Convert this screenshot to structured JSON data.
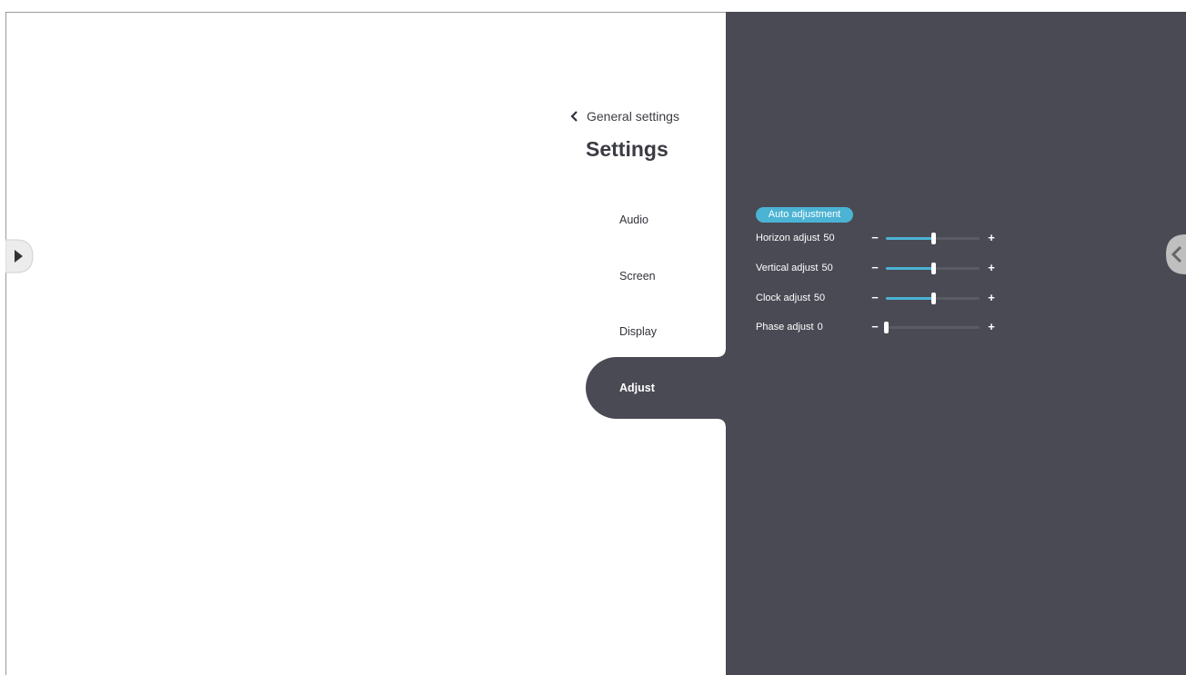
{
  "header": {
    "back_label": "General settings",
    "title": "Settings"
  },
  "menu": {
    "items": [
      {
        "label": "Audio",
        "active": false
      },
      {
        "label": "Screen",
        "active": false
      },
      {
        "label": "Display",
        "active": false
      },
      {
        "label": "Adjust",
        "active": true
      }
    ]
  },
  "adjust": {
    "auto_label": "Auto adjustment",
    "rows": [
      {
        "label": "Horizon adjust",
        "value": "50",
        "level": 0.5
      },
      {
        "label": "Vertical adjust",
        "value": "50",
        "level": 0.5
      },
      {
        "label": "Clock adjust",
        "value": "50",
        "level": 0.5
      },
      {
        "label": "Phase adjust",
        "value": "0",
        "level": 0
      }
    ],
    "minus_symbol": "−",
    "plus_symbol": "+"
  },
  "colors": {
    "accent": "#4bb3d4",
    "panel": "#4a4a55",
    "text_dark": "#3b3b44"
  },
  "icons": {
    "back": "chevron-left-icon",
    "left_handle": "expand-arrow-icon",
    "right_handle": "collapse-arrow-icon"
  }
}
